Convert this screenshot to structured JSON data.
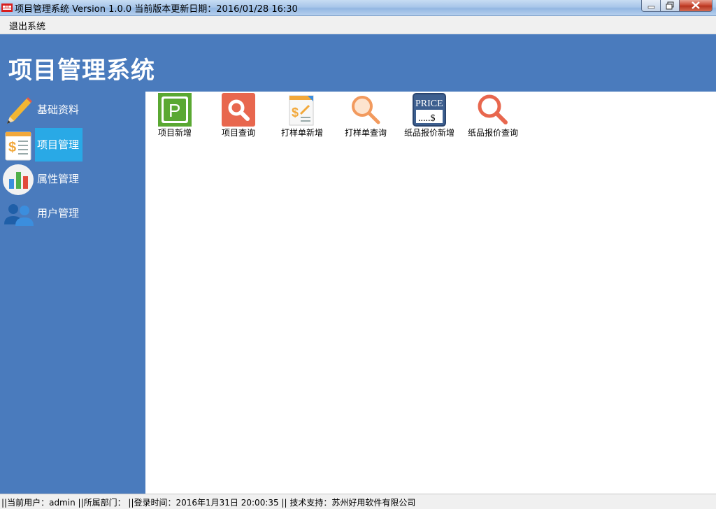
{
  "window": {
    "title": "项目管理系统 Version 1.0.0 当前版本更新日期：2016/01/28 16:30"
  },
  "menu": {
    "exit_label": "退出系统"
  },
  "header": {
    "title": "项目管理系统"
  },
  "sidebar": {
    "items": [
      {
        "label": "基础资料",
        "icon": "pencil-icon"
      },
      {
        "label": "项目管理",
        "icon": "document-dollar-icon",
        "active": true
      },
      {
        "label": "属性管理",
        "icon": "bar-chart-icon"
      },
      {
        "label": "用户管理",
        "icon": "users-icon"
      }
    ]
  },
  "toolbar": {
    "items": [
      {
        "label": "项目新增",
        "icon": "p-icon"
      },
      {
        "label": "项目查询",
        "icon": "search-icon"
      },
      {
        "label": "打样单新增",
        "icon": "document-dollar-icon"
      },
      {
        "label": "打样单查询",
        "icon": "magnifier-icon"
      },
      {
        "label": "纸品报价新增",
        "icon": "price-tag-icon"
      },
      {
        "label": "纸品报价查询",
        "icon": "magnifier-icon"
      }
    ]
  },
  "status": {
    "text": "||当前用户：admin  ||所属部门：  ||登录时间：2016年1月31日 20:00:35 || 技术支持：苏州好用软件有限公司"
  },
  "colors": {
    "header_blue": "#4a7bbd",
    "active_item": "#29a9e6",
    "search_red": "#e8674e",
    "p_green": "#5aa832"
  }
}
